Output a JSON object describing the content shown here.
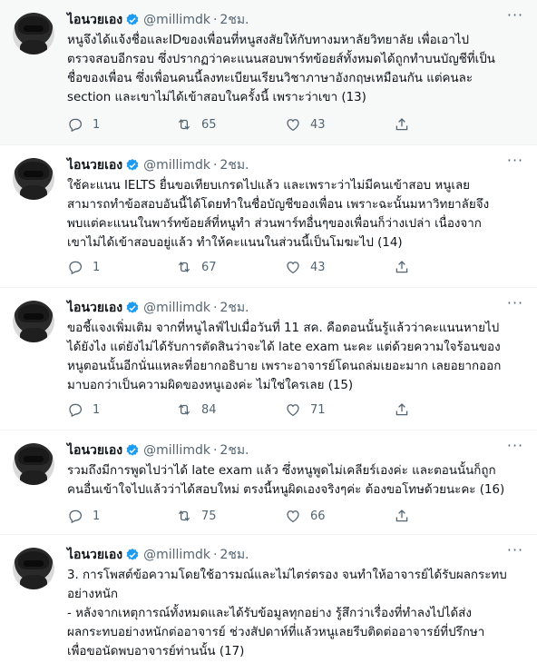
{
  "author": {
    "name": "ไอนวยเอง",
    "handle": "@millimdk",
    "separator": "·"
  },
  "tweets": [
    {
      "time": "2ชม.",
      "text": "หนูจึงได้แจ้งชื่อและIDของเพื่อนที่หนูสงสัยให้กับทางมหาลัยวิทยาลัย เพื่อเอาไป\nตรวจสอบอีกรอบ ซึ่งปรากฏว่าคะแนนสอบพาร์ทข้อยส์ทั้งหมดได้ถูกทำบนบัญชีที่เป็น\nชื่อของเพื่อน ซึ่งเพื่อนคนนี้ลงทะเบียนเรียนวิชาภาษาอังกฤษเหมือนกัน แต่คนละ\nsection และเขาไม่ได้เข้าสอบในครั้งนี้ เพราะว่าเขา (13)",
      "replies": "1",
      "retweets": "65",
      "likes": "43"
    },
    {
      "time": "2ชม.",
      "text": "ใช้คะแนน IELTS ยื่นขอเทียบเกรดไปแล้ว และเพราะว่าไม่มีคนเข้าสอบ หนูเลย\nสามารถทำข้อสอบอันนี้ได้โดยทำในชื่อบัญชีของเพื่อน เพราะฉะนั้นมหาวิทยาลัยจึง\nพบแต่คะแนนในพาร์ทข้อยส์ที่หนูทำ ส่วนพาร์ทอื่นๆของเพื่อนก็ว่างเปล่า เนื่องจาก\nเขาไม่ได้เข้าสอบอยู่แล้ว ทำให้คะแนนในส่วนนี้เป็นโมฆะไป (14)",
      "replies": "1",
      "retweets": "67",
      "likes": "43"
    },
    {
      "time": "2ชม.",
      "text": "ขอชี้แจงเพิ่มเติม จากที่หนูไลฟ์ไปเมื่อวันที่ 11 สค. คือตอนนั้นรู้แล้วว่าคะแนนหายไป\nได้ยังไง แต่ยังไม่ได้รับการตัดสินว่าจะได้ late exam นะคะ แต่ด้วยความใจร้อนของ\nหนูตอนนั้นอีกนั่นแหละที่อยากอธิบาย เพราะอาจารย์โดนถล่มเยอะมาก เลยอยากออก\nมาบอกว่าเป็นความผิดของหนูเองค่ะ ไม่ใช่ใครเลย (15)",
      "replies": "1",
      "retweets": "84",
      "likes": "71"
    },
    {
      "time": "2ชม.",
      "text": "รวมถึงมีการพูดไปว่าได้ late exam แล้ว ซึ่งหนูพูดไม่เคลียร์เองค่ะ และตอนนั้นก็ถูก\nคนอื่นเข้าใจไปแล้วว่าได้สอบใหม่ ตรงนี้หนูผิดเองจริงๆค่ะ ต้องขอโทษด้วยนะคะ (16)",
      "replies": "1",
      "retweets": "75",
      "likes": "66"
    },
    {
      "time": "2ชม.",
      "text": "3. การโพสต์ข้อความโดยใช้อารมณ์และไม่ไตร่ตรอง จนทำให้อาจารย์ได้รับผลกระทบ\nอย่างหนัก\n- หลังจากเหตุการณ์ทั้งหมดและได้รับข้อมูลทุกอย่าง รู้สึกว่าเรื่องที่ทำลงไปได้ส่ง\nผลกระทบอย่างหนักต่ออาจารย์ ช่วงสัปดาห์ที่แล้วหนูเลยรีบติดต่ออาจารย์ที่ปรึกษา\nเพื่อขอนัดพบอาจารย์ท่านนั้น (17)",
      "replies": "",
      "retweets": "",
      "likes": ""
    }
  ],
  "icons": {
    "reply": "reply-icon",
    "retweet": "retweet-icon",
    "like": "heart-icon",
    "share": "share-icon",
    "more": "more-icon",
    "verified": "verified-badge-icon"
  },
  "colors": {
    "verified": "#1d9bf0",
    "secondary_text": "#536471",
    "highlight_bg": "#f7f9f9"
  }
}
